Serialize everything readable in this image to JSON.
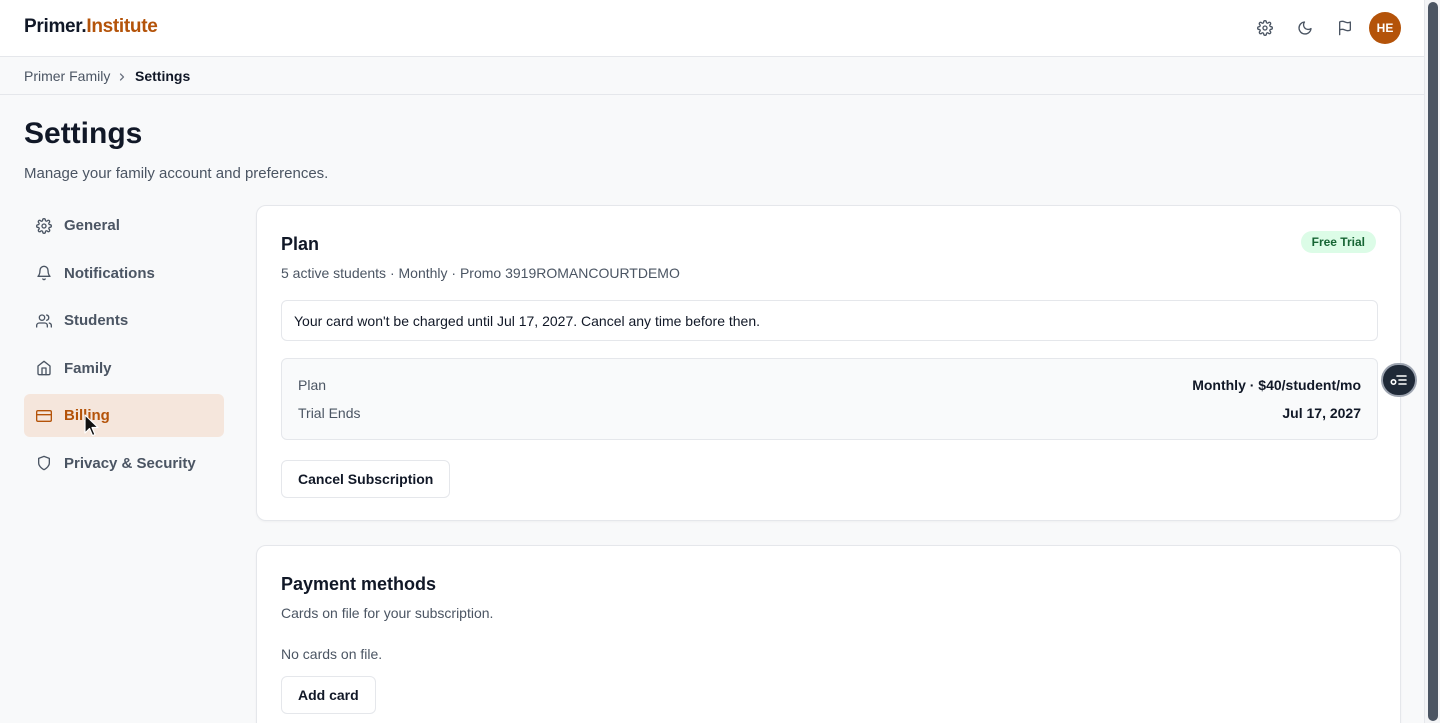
{
  "app": {
    "logo_part1": "Primer.",
    "logo_part2": "Institute",
    "user_initials": "HE",
    "accent_color": "#b45309"
  },
  "topbar": {
    "icons": [
      "gear-icon",
      "moon-icon",
      "flag-icon"
    ]
  },
  "breadcrumb": {
    "parent": "Primer Family",
    "current": "Settings"
  },
  "page": {
    "title": "Settings",
    "subtitle": "Manage your family account and preferences."
  },
  "sidebar": {
    "items": [
      {
        "label": "General",
        "icon": "gear-icon",
        "active": false
      },
      {
        "label": "Notifications",
        "icon": "bell-icon",
        "active": false
      },
      {
        "label": "Students",
        "icon": "users-icon",
        "active": false
      },
      {
        "label": "Family",
        "icon": "home-icon",
        "active": false
      },
      {
        "label": "Billing",
        "icon": "credit-card-icon",
        "active": true
      },
      {
        "label": "Privacy & Security",
        "icon": "shield-icon",
        "active": false
      }
    ]
  },
  "plan_card": {
    "title": "Plan",
    "badge": "Free Trial",
    "subtitle": "5 active students · Monthly · Promo 3919ROMANCOURTDEMO",
    "notice": "Your card won't be charged until Jul 17, 2027. Cancel any time before then.",
    "details": [
      {
        "label": "Plan",
        "value": "Monthly · $40/student/mo"
      },
      {
        "label": "Trial Ends",
        "value": "Jul 17, 2027"
      }
    ],
    "cancel_label": "Cancel Subscription"
  },
  "payment_card": {
    "title": "Payment methods",
    "subtitle": "Cards on file for your subscription.",
    "empty_text": "No cards on file.",
    "add_label": "Add card"
  }
}
